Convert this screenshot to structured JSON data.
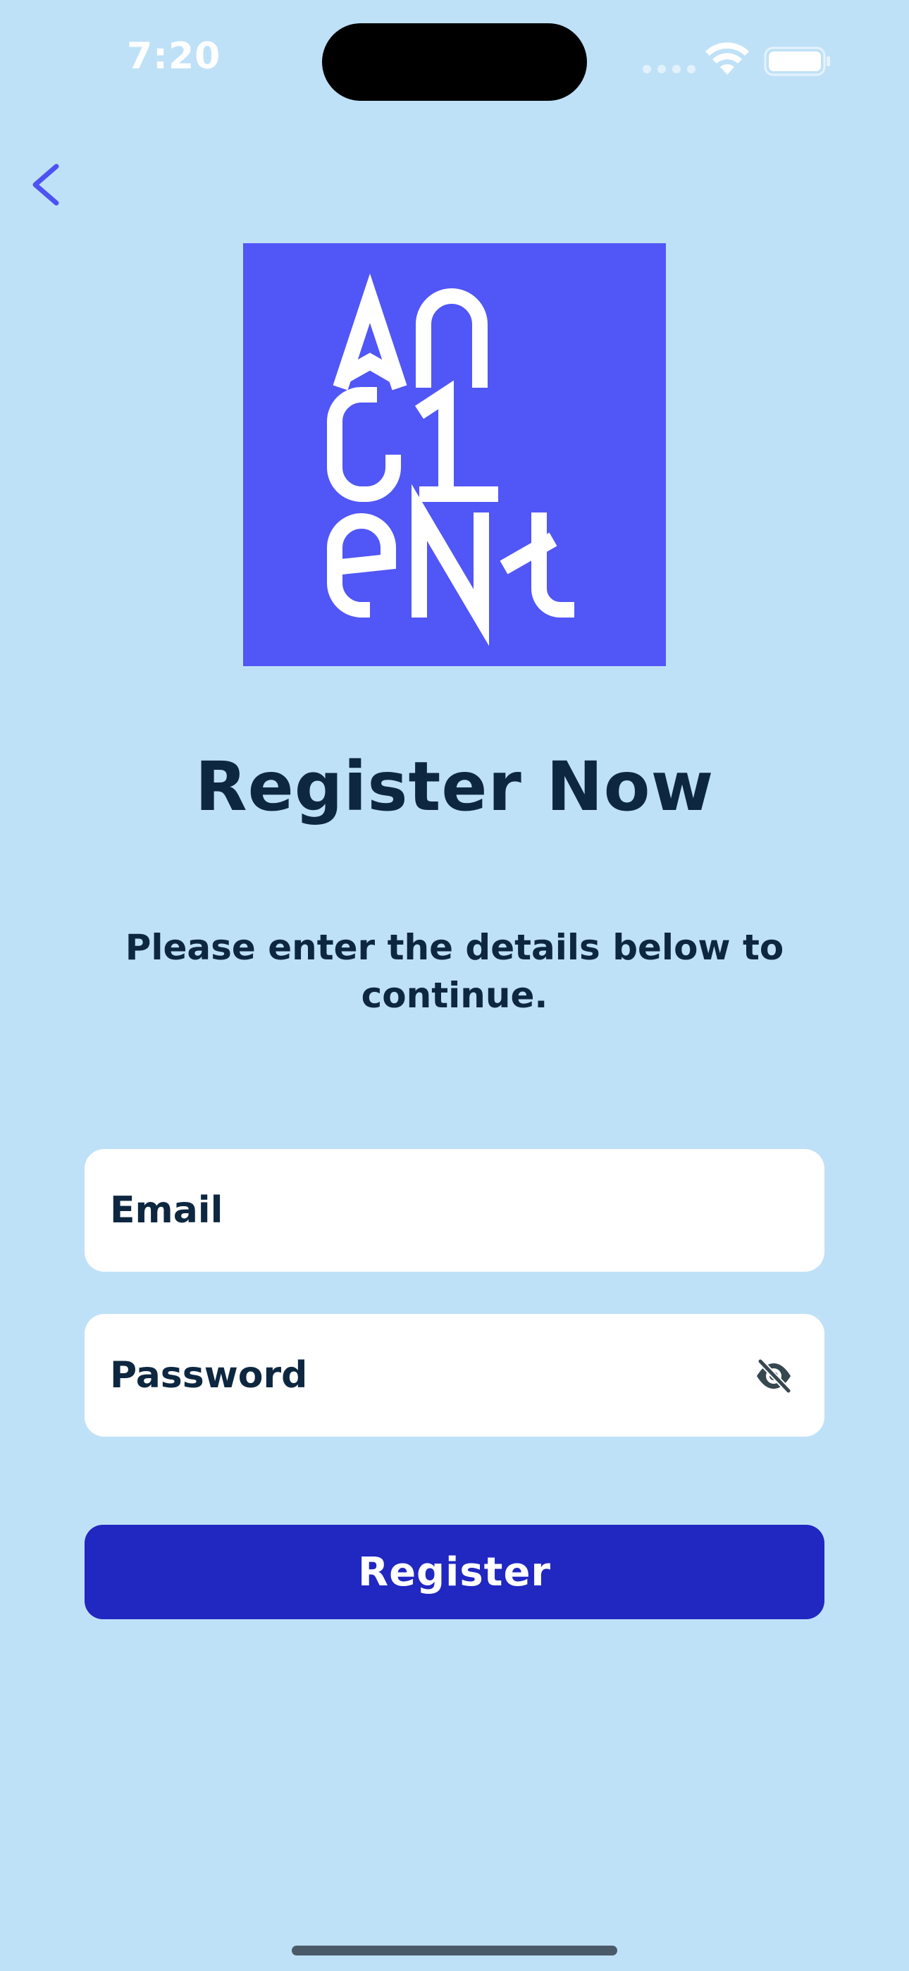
{
  "status_bar": {
    "time": "7:20",
    "icons": [
      "signal-dots-icon",
      "wifi-icon",
      "battery-icon"
    ]
  },
  "navigation": {
    "back_icon": "chevron-left-icon"
  },
  "logo": {
    "text_lines": [
      "AN",
      "CI",
      "ENT"
    ],
    "alt": "Ancient"
  },
  "header": {
    "title": "Register Now",
    "subtitle": "Please enter the details below to continue."
  },
  "form": {
    "email": {
      "placeholder": "Email",
      "value": ""
    },
    "password": {
      "placeholder": "Password",
      "value": "",
      "toggle_icon": "eye-slash-icon"
    },
    "submit_label": "Register"
  },
  "colors": {
    "background": "#bfe1f7",
    "logo_background": "#5156f7",
    "primary_button": "#2127c1",
    "text_primary": "#0e2740",
    "back_icon": "#4d52f2"
  }
}
